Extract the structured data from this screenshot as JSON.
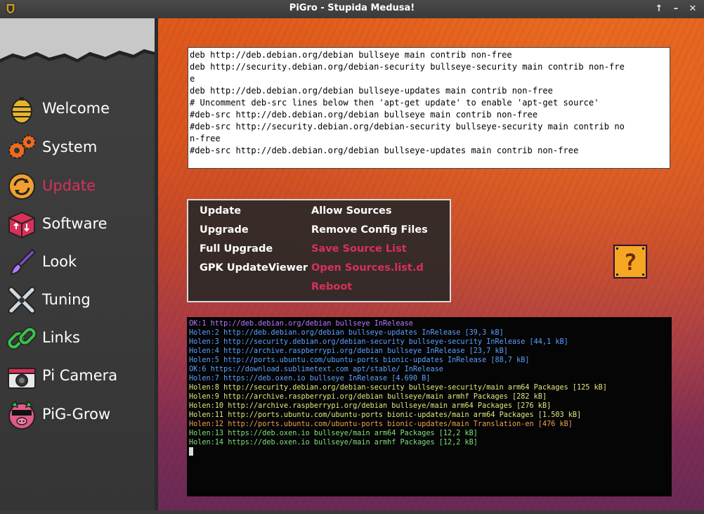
{
  "window": {
    "title": "PiGro - Stupida Medusa!",
    "buttons": [
      "↑",
      "–",
      "✕"
    ]
  },
  "sidebar": {
    "items": [
      {
        "label": "Welcome",
        "icon": "bee-hive-icon",
        "active": false
      },
      {
        "label": "System",
        "icon": "gears-icon",
        "active": false
      },
      {
        "label": "Update",
        "icon": "refresh-icon",
        "active": true
      },
      {
        "label": "Software",
        "icon": "package-box-icon",
        "active": false
      },
      {
        "label": "Look",
        "icon": "paintbrush-icon",
        "active": false
      },
      {
        "label": "Tuning",
        "icon": "wrench-tools-icon",
        "active": false
      },
      {
        "label": "Links",
        "icon": "chain-link-icon",
        "active": false
      },
      {
        "label": "Pi Camera",
        "icon": "camera-icon",
        "active": false
      },
      {
        "label": "PiG-Grow",
        "icon": "pig-mascot-icon",
        "active": false
      }
    ],
    "active_color": "#d9305a"
  },
  "sources_list": {
    "text": "deb http://deb.debian.org/debian bullseye main contrib non-free\ndeb http://security.debian.org/debian-security bullseye-security main contrib non-fre\ne\ndeb http://deb.debian.org/debian bullseye-updates main contrib non-free\n# Uncomment deb-src lines below then 'apt-get update' to enable 'apt-get source'\n#deb-src http://deb.debian.org/debian bullseye main contrib non-free\n#deb-src http://security.debian.org/debian-security bullseye-security main contrib no\nn-free\n#deb-src http://deb.debian.org/debian bullseye-updates main contrib non-free"
  },
  "actions": {
    "left": [
      "Update",
      "Upgrade",
      "Full Upgrade",
      "GPK UpdateViewer"
    ],
    "right": [
      {
        "label": "Allow Sources",
        "color": "#ffffff"
      },
      {
        "label": "Remove Config Files",
        "color": "#ffffff"
      },
      {
        "label": "Save Source List",
        "color": "#d9305a"
      },
      {
        "label": "Open Sources.list.d",
        "color": "#d9305a"
      },
      {
        "label": "Reboot",
        "color": "#d9305a"
      }
    ]
  },
  "help_block": {
    "icon": "question-block-icon",
    "glyph": "?"
  },
  "terminal": {
    "lines": [
      {
        "text": "OK:1 http://deb.debian.org/debian bullseye InRelease",
        "color": "c-blue"
      },
      {
        "text": "Holen:2 http://deb.debian.org/debian bullseye-updates InRelease [39,3 kB]",
        "color": "c-purple"
      },
      {
        "text": "Holen:3 http://security.debian.org/debian-security bullseye-security InRelease [44,1 kB]",
        "color": "c-blue"
      },
      {
        "text": "Holen:4 http://archive.raspberrypi.org/debian bullseye InRelease [23,7 kB]",
        "color": "c-blue"
      },
      {
        "text": "Holen:5 http://ports.ubuntu.com/ubuntu-ports bionic-updates InRelease [88,7 kB]",
        "color": "c-blue"
      },
      {
        "text": "OK:6 https://download.sublimetext.com apt/stable/ InRelease",
        "color": "c-blue"
      },
      {
        "text": "Holen:7 https://deb.oxen.io bullseye InRelease [4.690 B]",
        "color": "c-blue"
      },
      {
        "text": "Holen:8 http://security.debian.org/debian-security bullseye-security/main arm64 Packages [125 kB]",
        "color": "c-blue"
      },
      {
        "text": "Holen:9 http://archive.raspberrypi.org/debian bullseye/main armhf Packages [282 kB]",
        "color": "c-blue"
      },
      {
        "text": "Holen:10 http://archive.raspberrypi.org/debian bullseye/main arm64 Packages [276 kB]",
        "color": "c-blue"
      },
      {
        "text": "Holen:11 http://ports.ubuntu.com/ubuntu-ports bionic-updates/main arm64 Packages [1.503 kB]",
        "color": "c-blue"
      },
      {
        "text": "Holen:12 http://ports.ubuntu.com/ubuntu-ports bionic-updates/main Translation-en [476 kB]",
        "color": "c-blue"
      },
      {
        "text": "Holen:13 https://deb.oxen.io bullseye/main arm64 Packages [12,2 kB]",
        "color": "c-blue"
      },
      {
        "text": "Holen:14 https://deb.oxen.io bullseye/main armhf Packages [12,2 kB]",
        "color": "c-blue"
      }
    ]
  }
}
